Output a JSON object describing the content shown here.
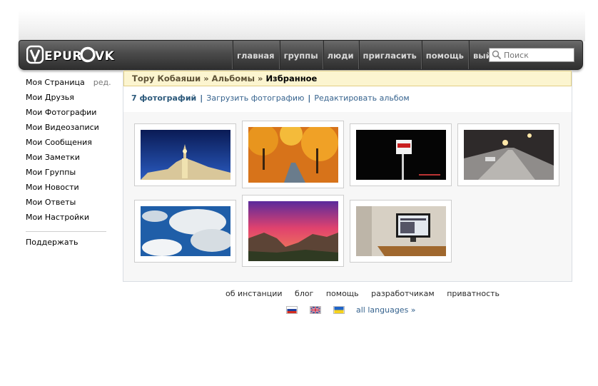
{
  "header": {
    "logo_text": "VEPUROVK",
    "nav": [
      "главная",
      "группы",
      "люди",
      "пригласить",
      "помощь",
      "выйти"
    ],
    "search_placeholder": "Поиск"
  },
  "sidebar": {
    "items": [
      "Моя Страница",
      "Мои Друзья",
      "Мои Фотографии",
      "Мои Видеозаписи",
      "Мои Сообщения",
      "Мои Заметки",
      "Мои Группы",
      "Мои Новости",
      "Мои Ответы",
      "Мои Настройки"
    ],
    "edit_label": "ред.",
    "support": "Поддержать"
  },
  "breadcrumb": {
    "user": "Тору Кобаяши",
    "sep": " » ",
    "albums": "Альбомы",
    "current": "Избранное"
  },
  "album": {
    "count": "7 фотографий",
    "upload": "Загрузить фотографию",
    "edit": "Редактировать альбом",
    "photos": [
      {
        "name": "building-night"
      },
      {
        "name": "autumn-road"
      },
      {
        "name": "sign-night"
      },
      {
        "name": "snowy-street-night"
      },
      {
        "name": "clouds-sky"
      },
      {
        "name": "valley-sunset"
      },
      {
        "name": "office-monitor"
      }
    ]
  },
  "footer": {
    "links": [
      "об инстанции",
      "блог",
      "помощь",
      "разработчикам",
      "приватность"
    ],
    "languages": "all languages »"
  },
  "colors": {
    "link": "#36638e",
    "crumb_bg": "#fcf5d0",
    "header_dark": "#2f2f2f"
  }
}
